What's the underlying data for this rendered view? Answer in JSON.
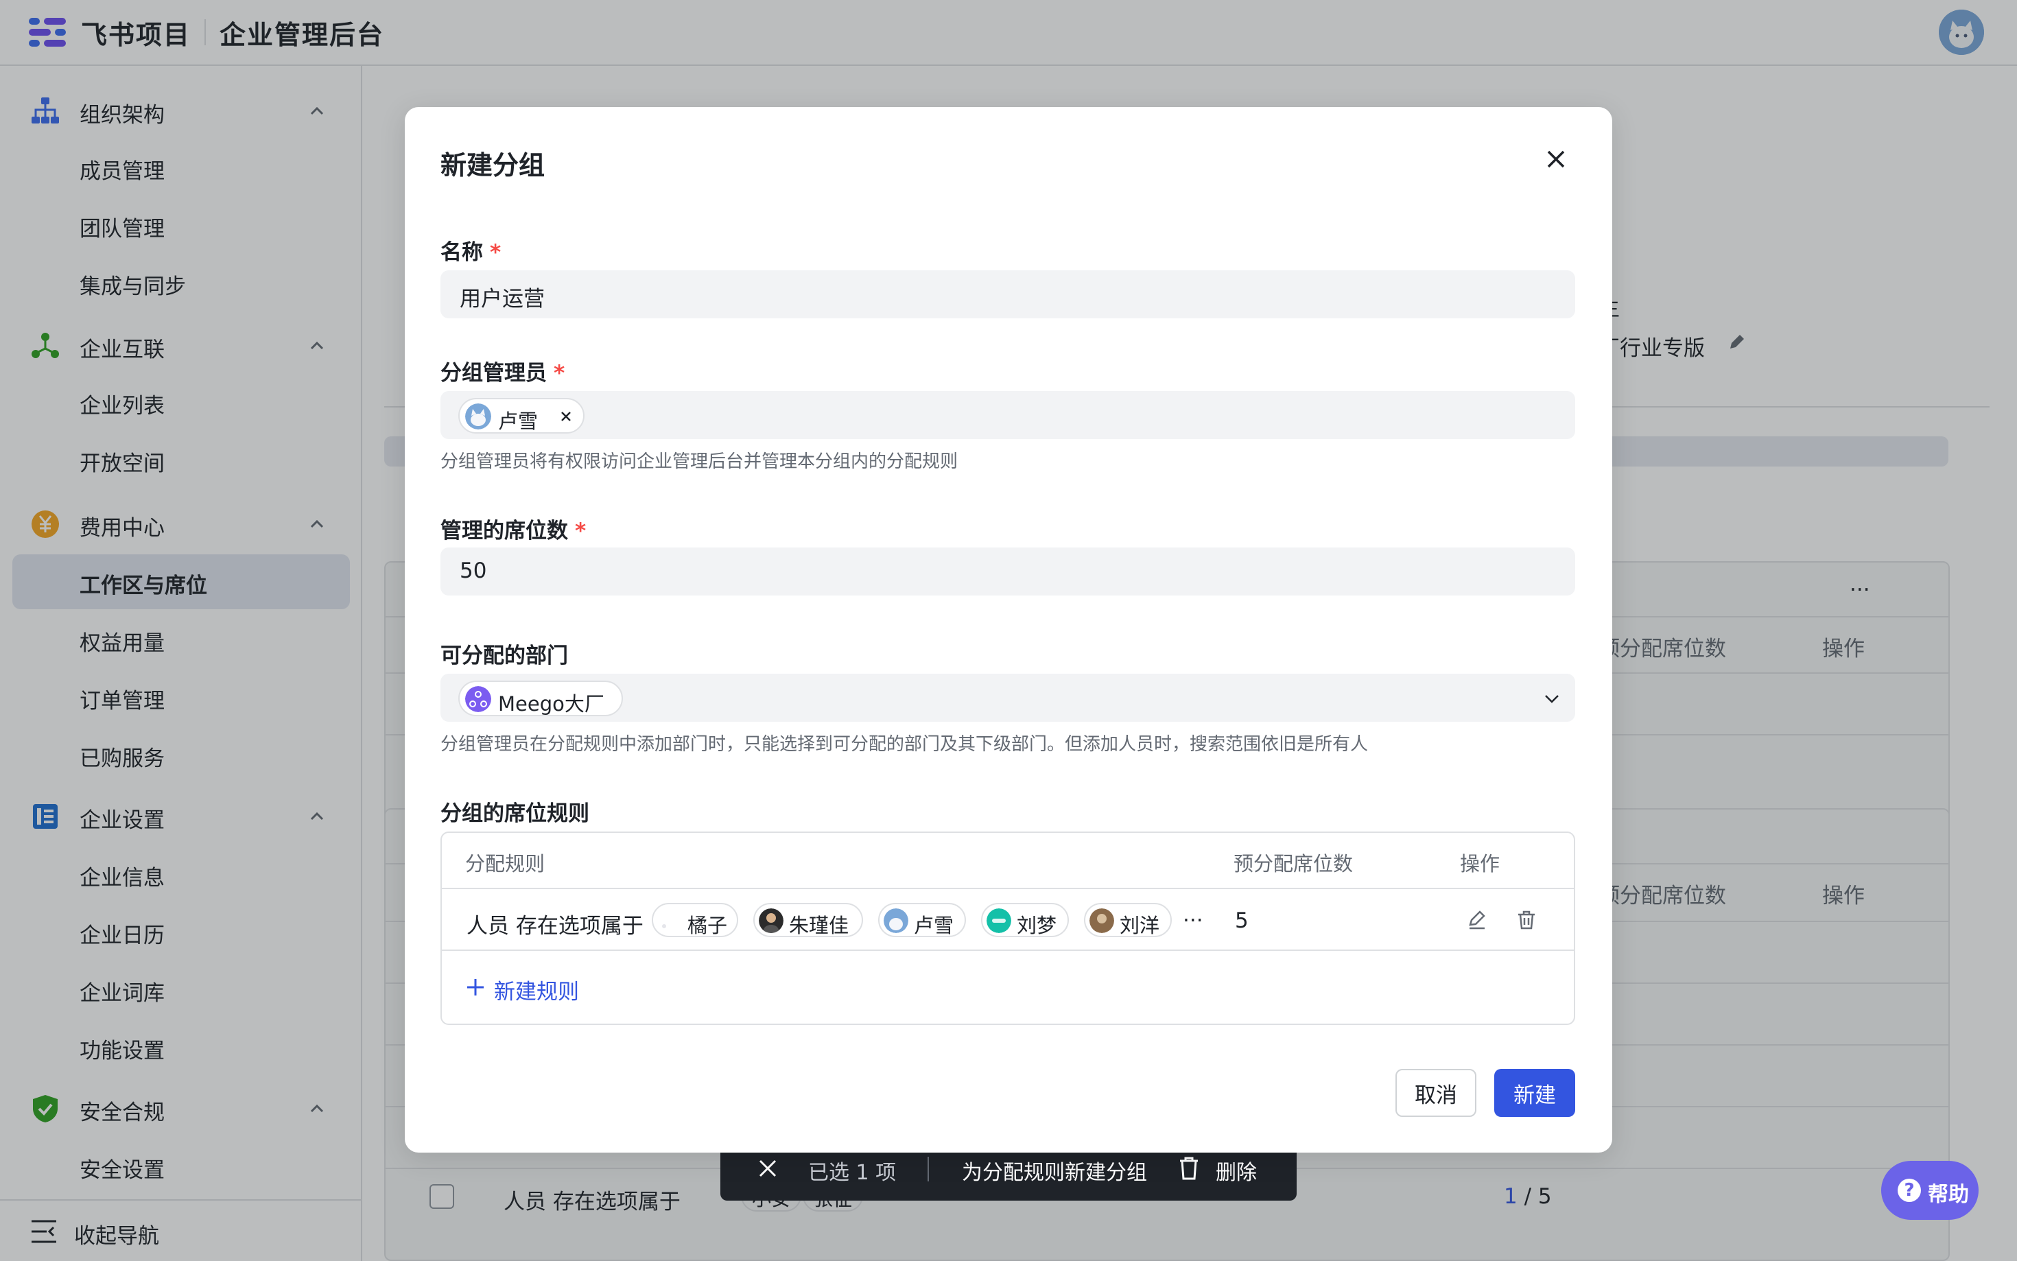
{
  "header": {
    "brand": "飞书项目",
    "console_title": "企业管理后台"
  },
  "sidebar": {
    "groups": [
      {
        "label": "组织架构",
        "items": [
          "成员管理",
          "团队管理",
          "集成与同步"
        ]
      },
      {
        "label": "企业互联",
        "items": [
          "企业列表",
          "开放空间"
        ]
      },
      {
        "label": "费用中心",
        "items": [
          "工作区与席位",
          "权益用量",
          "订单管理",
          "已购服务"
        ]
      },
      {
        "label": "企业设置",
        "items": [
          "企业信息",
          "企业日历",
          "企业词库",
          "功能设置"
        ]
      },
      {
        "label": "安全合规",
        "items": [
          "安全设置"
        ]
      }
    ],
    "collapse_label": "收起导航"
  },
  "background": {
    "info_fragment_1": "主",
    "info_fragment_2": "厂行业专版",
    "col_preassign": "预分配席位数",
    "col_ops": "操作",
    "more_dots": "···",
    "row_text": "人员 存在选项属于",
    "row_tags": [
      "小安",
      "张征"
    ],
    "row_progress_used": "1",
    "row_progress_rest": " / 5"
  },
  "floatbar": {
    "selected": "已选 1 项",
    "new_group": "为分配规则新建分组",
    "delete": "删除"
  },
  "help": {
    "label": "帮助"
  },
  "modal": {
    "title": "新建分组",
    "name_label": "名称",
    "name_value": "用户运营",
    "admin_label": "分组管理员",
    "admin_tag": "卢雪",
    "admin_hint": "分组管理员将有权限访问企业管理后台并管理本分组内的分配规则",
    "seats_label": "管理的席位数",
    "seats_value": "50",
    "dept_label": "可分配的部门",
    "dept_tag": "Meego大厂",
    "dept_hint": "分组管理员在分配规则中添加部门时，只能选择到可分配的部门及其下级部门。但添加人员时，搜索范围依旧是所有人",
    "rules_label": "分组的席位规则",
    "rules_table": {
      "headers": [
        "分配规则",
        "预分配席位数",
        "操作"
      ],
      "row": {
        "text": "人员 存在选项属于",
        "members": [
          "橘子",
          "朱瑾佳",
          "卢雪",
          "刘梦",
          "刘洋"
        ],
        "more": "···",
        "seats": "5"
      },
      "add_rule": "新建规则"
    },
    "cancel": "取消",
    "confirm": "新建"
  },
  "colors": {
    "primary": "#3355e0",
    "required": "#f54a45",
    "help": "#6b63e8",
    "active_nav": "#e1e6ef"
  }
}
